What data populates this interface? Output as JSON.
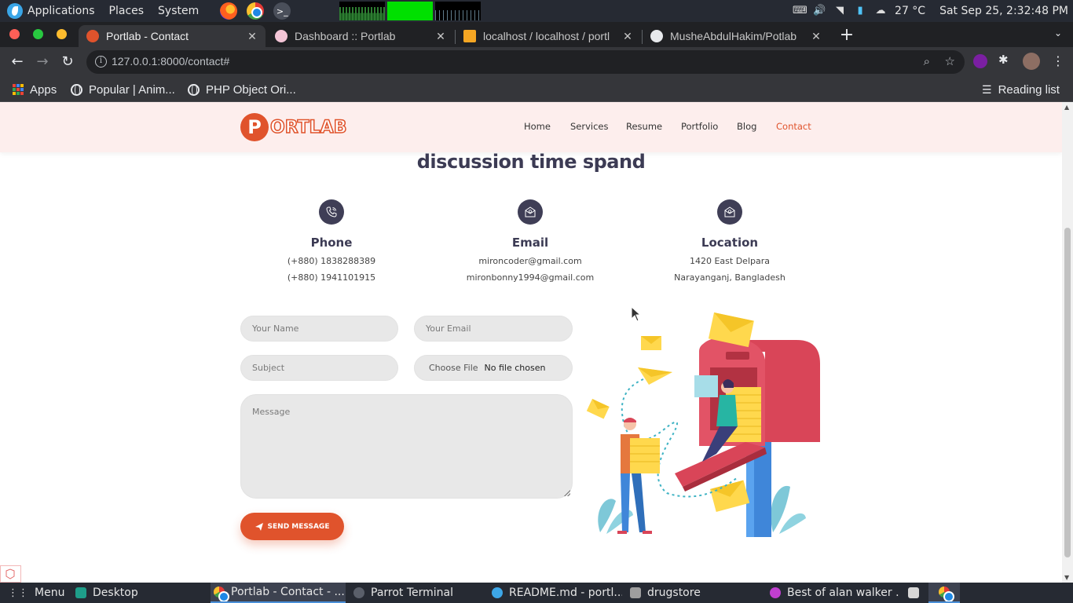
{
  "desktop": {
    "menus": [
      "Applications",
      "Places",
      "System"
    ],
    "weather": "27 °C",
    "clock": "Sat Sep 25,  2:32:48 PM"
  },
  "browser": {
    "tabs": [
      {
        "title": "Portlab - Contact",
        "active": true
      },
      {
        "title": "Dashboard :: Portlab",
        "active": false
      },
      {
        "title": "localhost / localhost / portl",
        "active": false
      },
      {
        "title": "MusheAbdulHakim/Potlab",
        "active": false
      }
    ],
    "url": "127.0.0.1:8000/contact#",
    "bookmarks": [
      "Apps",
      "Popular | Anim...",
      "PHP Object Ori..."
    ],
    "reading_list": "Reading list"
  },
  "site": {
    "logo_letter": "P",
    "logo_text": "ORTLAB",
    "nav": [
      "Home",
      "Services",
      "Resume",
      "Portfolio",
      "Blog",
      "Contact"
    ],
    "active_nav": "Contact",
    "section_title": "discussion time spand",
    "contact_info": [
      {
        "icon": "phone-icon",
        "title": "Phone",
        "lines": [
          "(+880) 1838288389",
          "(+880) 1941101915"
        ]
      },
      {
        "icon": "email-icon",
        "title": "Email",
        "lines": [
          "mironcoder@gmail.com",
          "mironbonny1994@gmail.com"
        ]
      },
      {
        "icon": "location-icon",
        "title": "Location",
        "lines": [
          "1420 East Delpara",
          "Narayanganj, Bangladesh"
        ]
      }
    ],
    "form": {
      "name_placeholder": "Your Name",
      "email_placeholder": "Your Email",
      "subject_placeholder": "Subject",
      "file_button": "Choose File",
      "file_status": "No file chosen",
      "message_placeholder": "Message",
      "submit_label": "SEND MESSAGE"
    },
    "accent_color": "#e0532c"
  },
  "taskbar": {
    "menu_label": "Menu",
    "items": [
      "Desktop",
      "Portlab - Contact - ...",
      "Parrot Terminal",
      "README.md - portl...",
      "drugstore",
      "Best of alan walker ..."
    ]
  }
}
